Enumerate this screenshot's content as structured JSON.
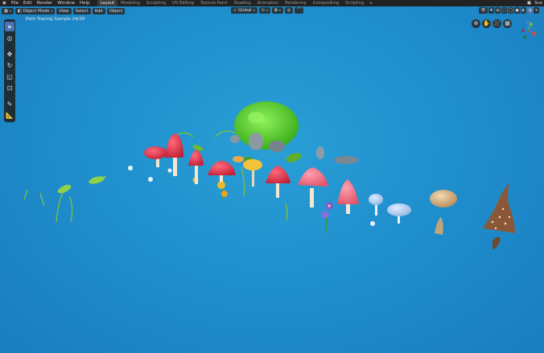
{
  "menu": {
    "items": [
      "File",
      "Edit",
      "Render",
      "Window",
      "Help"
    ]
  },
  "workspaces": {
    "tabs": [
      "Layout",
      "Modeling",
      "Sculpting",
      "UV Editing",
      "Texture Paint",
      "Shading",
      "Animation",
      "Rendering",
      "Compositing",
      "Scripting"
    ],
    "active": "Layout"
  },
  "scene": {
    "label": "Sce"
  },
  "header": {
    "mode": "Object Mode",
    "view": "View",
    "select": "Select",
    "add": "Add",
    "object": "Object",
    "transform_orientation": "Global"
  },
  "viewport": {
    "overlay_text": "Path Tracing Sample 24/30"
  },
  "icons": {
    "select": "cursor-icon",
    "cursor3d": "target-icon",
    "move": "move-icon",
    "rotate": "rotate-icon",
    "scale": "scale-icon",
    "transform": "transform-icon",
    "annotate": "pencil-icon",
    "measure": "ruler-icon"
  },
  "colors": {
    "viewport_bg": "#1f8fcd",
    "active_tool": "#4772b3",
    "mushroom_red": "#d8334a",
    "moss_green": "#5bd12e"
  }
}
